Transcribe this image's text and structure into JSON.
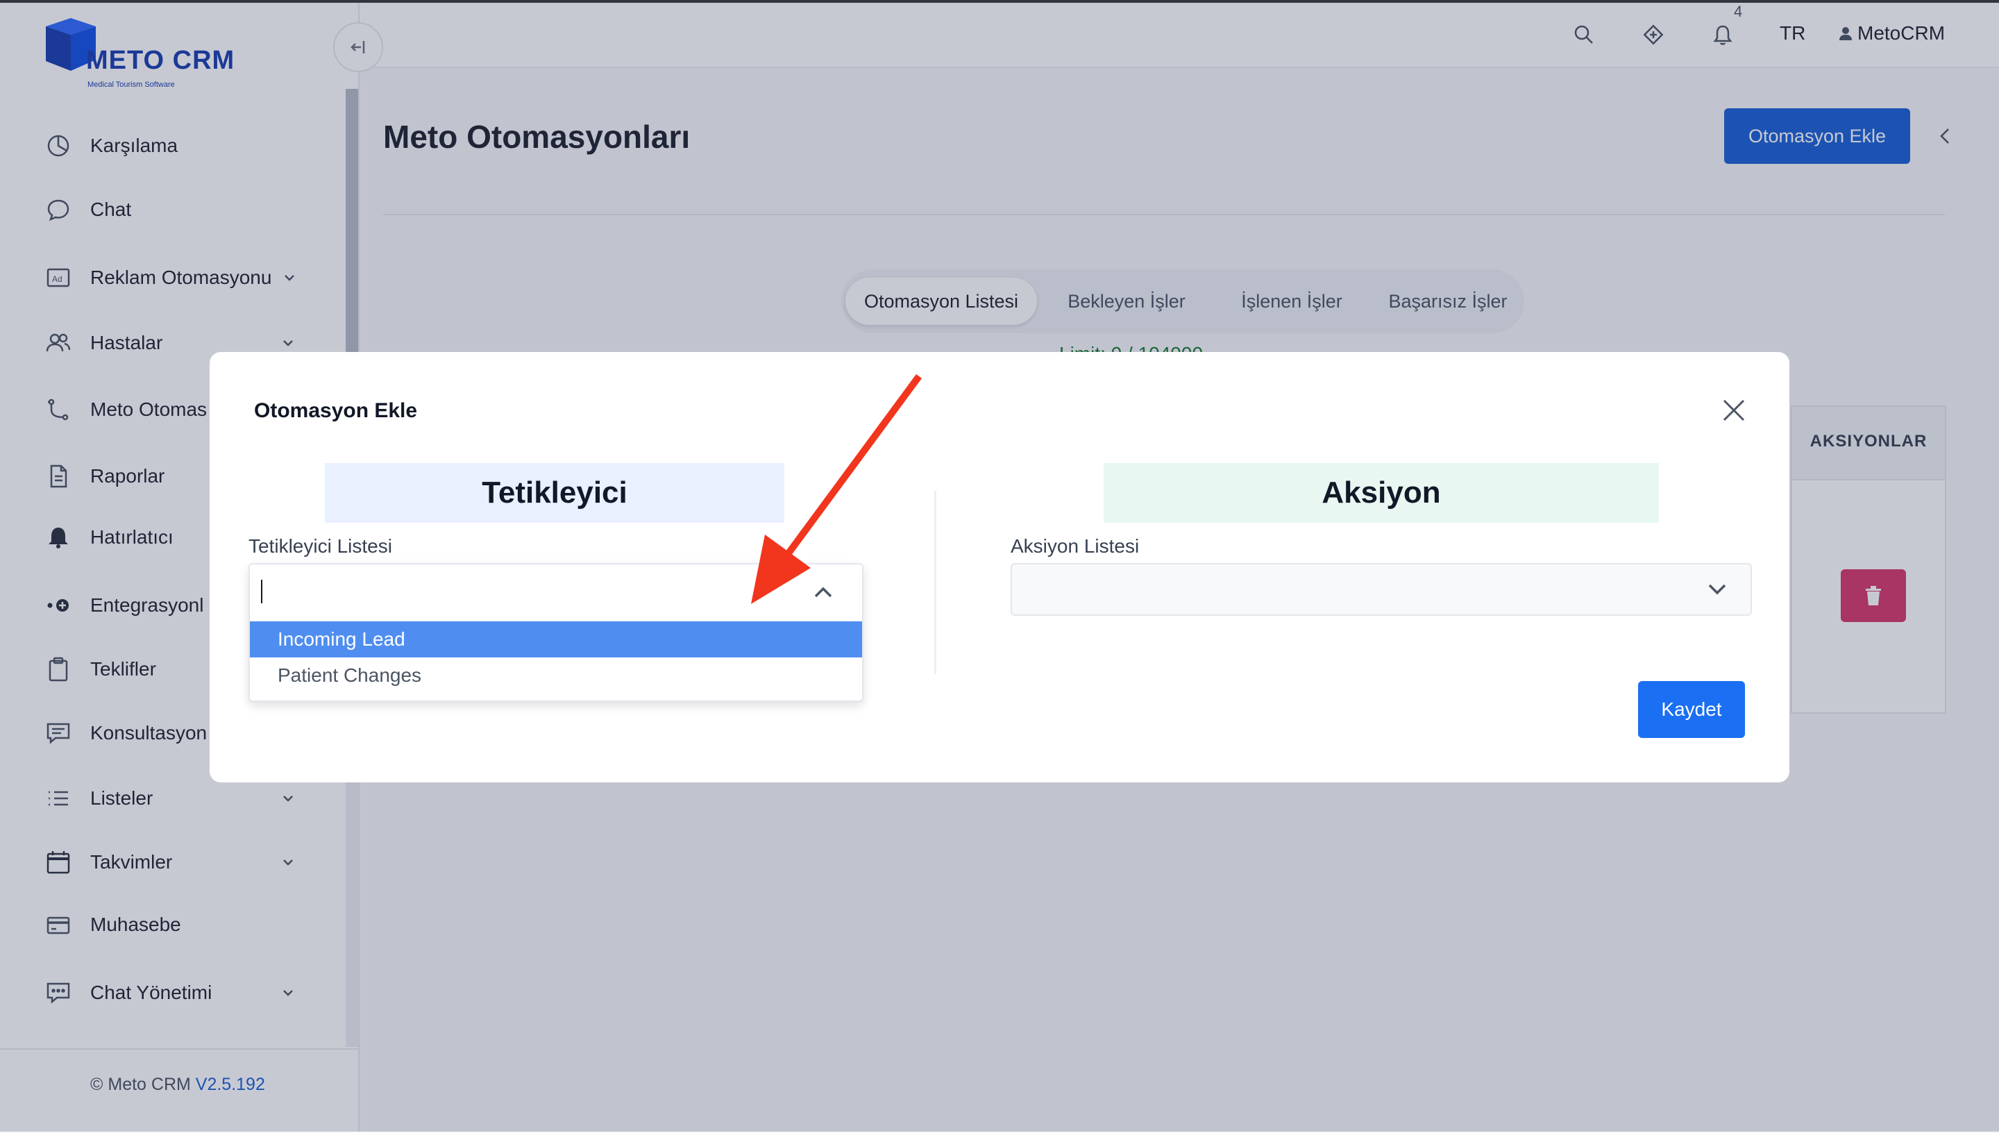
{
  "brand": {
    "name": "METO CRM",
    "tagline": "Medical Tourism Software",
    "color": "#1a3fb0"
  },
  "header": {
    "notification_count": "4",
    "language": "TR",
    "user_name": "MetoCRM",
    "icons": [
      "search-icon",
      "integration-icon",
      "bell-icon",
      "user-icon"
    ]
  },
  "sidebar": {
    "items": [
      {
        "label": "Karşılama",
        "icon": "pie-chart-icon",
        "has_submenu": false
      },
      {
        "label": "Chat",
        "icon": "chat-bubble-icon",
        "has_submenu": false
      },
      {
        "label": "Reklam Otomasyonu",
        "icon": "ad-icon",
        "has_submenu": true
      },
      {
        "label": "Hastalar",
        "icon": "users-icon",
        "has_submenu": true
      },
      {
        "label": "Meto Otomas",
        "icon": "flow-icon",
        "has_submenu": false
      },
      {
        "label": "Raporlar",
        "icon": "document-icon",
        "has_submenu": false
      },
      {
        "label": "Hatırlatıcı",
        "icon": "bell-icon",
        "has_submenu": false
      },
      {
        "label": "Entegrasyonl",
        "icon": "plug-icon",
        "has_submenu": false
      },
      {
        "label": "Teklifler",
        "icon": "clipboard-icon",
        "has_submenu": false
      },
      {
        "label": "Konsultasyon",
        "icon": "message-icon",
        "has_submenu": false
      },
      {
        "label": "Listeler",
        "icon": "list-icon",
        "has_submenu": true
      },
      {
        "label": "Takvimler",
        "icon": "calendar-icon",
        "has_submenu": true
      },
      {
        "label": "Muhasebe",
        "icon": "card-icon",
        "has_submenu": false
      },
      {
        "label": "Chat Yönetimi",
        "icon": "chat-manage-icon",
        "has_submenu": true
      }
    ],
    "footer_prefix": "© Meto CRM",
    "footer_version": "V2.5.192"
  },
  "main": {
    "page_title": "Meto Otomasyonları",
    "add_button_label": "Otomasyon Ekle",
    "tabs": [
      {
        "label": "Otomasyon Listesi",
        "active": true
      },
      {
        "label": "Bekleyen İşler",
        "active": false
      },
      {
        "label": "İşlenen İşler",
        "active": false
      },
      {
        "label": "Başarısız İşler",
        "active": false
      }
    ],
    "limit_text": "Limit: 0 / 104000",
    "table_header_actions": "AKSIYONLAR",
    "accent_color": "#1b62d6",
    "delete_color": "#d63a6b"
  },
  "modal": {
    "title": "Otomasyon Ekle",
    "trigger": {
      "heading": "Tetikleyici",
      "field_label": "Tetikleyici Listesi",
      "input_value": "",
      "options": [
        "Incoming Lead",
        "Patient Changes"
      ],
      "highlighted_option": "Incoming Lead"
    },
    "action": {
      "heading": "Aksiyon",
      "field_label": "Aksiyon Listesi",
      "selected_value": ""
    },
    "save_label": "Kaydet"
  },
  "annotation": {
    "color": "#f2351d"
  }
}
